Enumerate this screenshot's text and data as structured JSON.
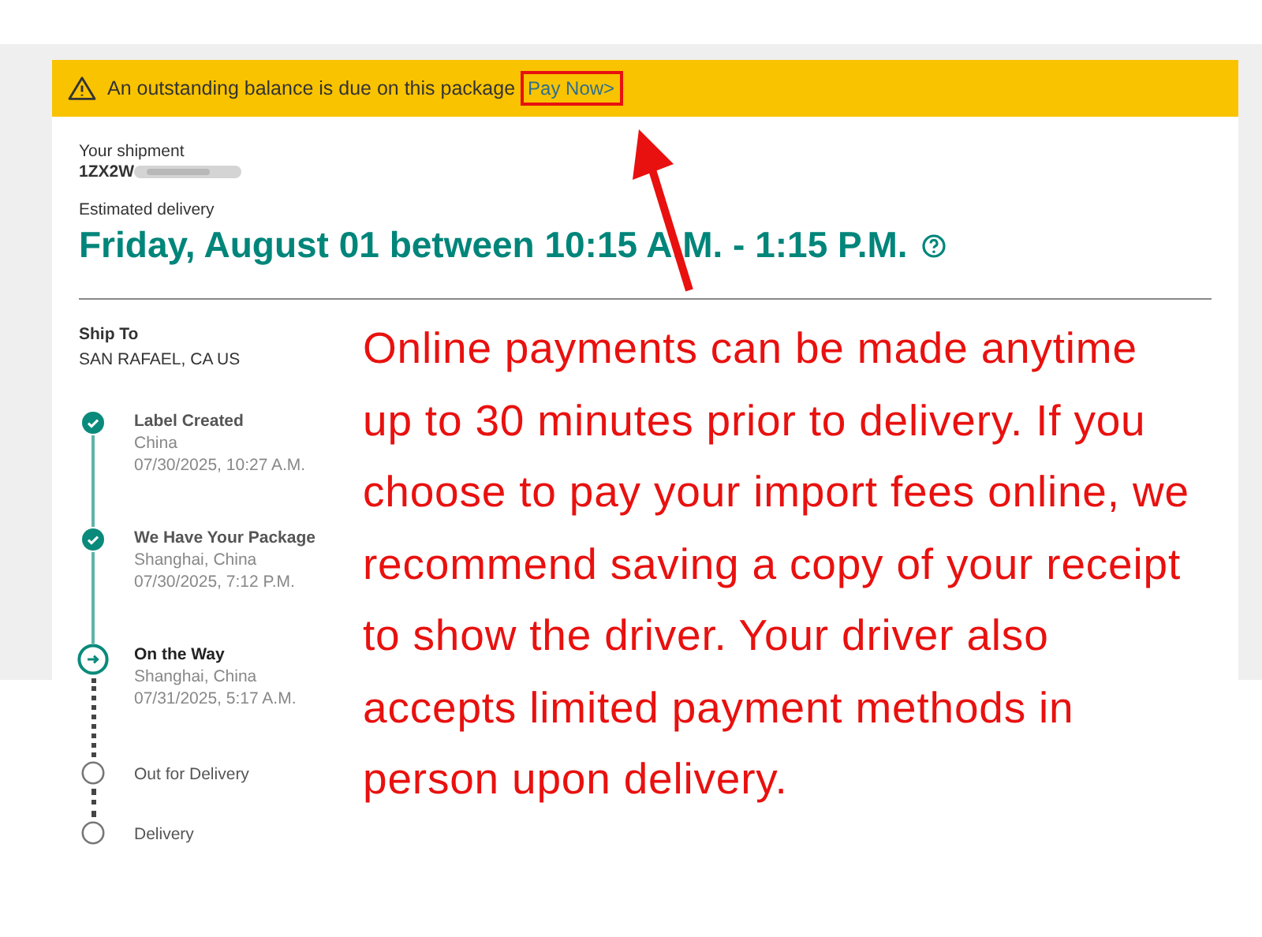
{
  "banner": {
    "message": "An outstanding balance is due on this package",
    "link": "Pay Now>"
  },
  "shipment": {
    "label": "Your shipment",
    "tracking": "1ZX2W",
    "estimate_label": "Estimated delivery",
    "estimate": "Friday, August 01 between 10:15 A.M. - 1:15 P.M."
  },
  "ship_to": {
    "label": "Ship To",
    "address": "SAN RAFAEL, CA US"
  },
  "steps": [
    {
      "kind": "done",
      "title": "Label Created",
      "location": "China",
      "time": "07/30/2025, 10:27 A.M."
    },
    {
      "kind": "done",
      "title": "We Have Your Package",
      "location": "Shanghai, China",
      "time": "07/30/2025, 7:12 P.M."
    },
    {
      "kind": "current",
      "title": "On the Way",
      "location": "Shanghai, China",
      "time": "07/31/2025, 5:17 A.M."
    },
    {
      "kind": "pending",
      "title": "Out for Delivery"
    },
    {
      "kind": "pending",
      "title": "Delivery"
    }
  ],
  "annotation": {
    "text": "Online payments can be made anytime up to 30 minutes prior to delivery. If you choose to pay your import fees online, we recommend saving a copy of your receipt to show the driver. Your driver also accepts limited payment methods in person upon delivery."
  }
}
